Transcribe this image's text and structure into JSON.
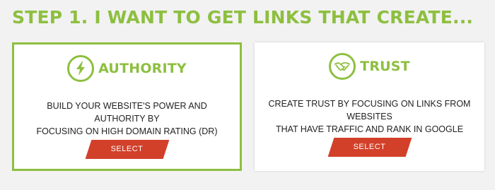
{
  "heading": "STEP 1. I WANT TO GET LINKS THAT CREATE...",
  "colors": {
    "accent": "#8dbf3f",
    "button": "#d2402a",
    "background": "#f2f2f2"
  },
  "cards": [
    {
      "icon": "lightning-bolt-icon",
      "title": "AUTHORITY",
      "description": "BUILD YOUR WEBSITE'S POWER AND AUTHORITY BY\nFOCUSING ON HIGH DOMAIN RATING (DR) BACKLINKS",
      "button_label": "SELECT",
      "selected": true
    },
    {
      "icon": "handshake-icon",
      "title": "TRUST",
      "description": "CREATE TRUST BY FOCUSING ON LINKS FROM WEBSITES\nTHAT HAVE TRAFFIC AND RANK IN GOOGLE",
      "button_label": "SELECT",
      "selected": false
    }
  ]
}
